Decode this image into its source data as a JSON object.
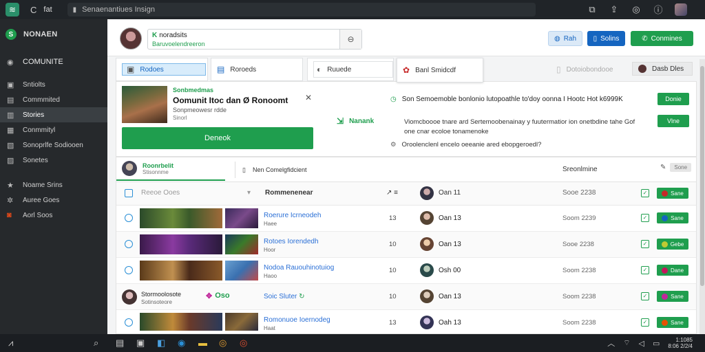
{
  "browser": {
    "back_glyph": "C",
    "tab_text": "fat",
    "address": "Senaenantiues Insign",
    "right_icons": [
      "⧉",
      "⇪",
      "◎",
      "ⓘ"
    ]
  },
  "sidebar": {
    "brand": "NONAEN",
    "section": "COMUNITE",
    "items": [
      {
        "label": "Sntiolts",
        "icon": "folder-icon"
      },
      {
        "label": "Commmited",
        "icon": "stack-icon"
      },
      {
        "label": "Stories",
        "icon": "book-icon",
        "active": true
      },
      {
        "label": "Conmmityl",
        "icon": "grid-icon"
      },
      {
        "label": "Sonoprlfe Sodiooen",
        "icon": "list-icon"
      },
      {
        "label": "Sonetes",
        "icon": "card-icon"
      }
    ],
    "items2": [
      {
        "label": "Noame Srins",
        "icon": "star-icon"
      },
      {
        "label": "Auree Goes",
        "icon": "gear-icon"
      },
      {
        "label": "Aorl Soos",
        "icon": "flag-icon"
      }
    ]
  },
  "profile": {
    "name": "noradsits",
    "subtitle": "Baruvoelendreeron",
    "buttons": {
      "b1": "Rah",
      "b2": "Solins",
      "b3": "Conmines"
    }
  },
  "tabs": {
    "t1": "Rodoes",
    "t2": "Roroeds",
    "t3": "Ruuede",
    "t4": "Banl Smidcdf",
    "t5": "Dotoiobondooe",
    "t6": "Dasb Dles"
  },
  "promo": {
    "tag": "Sonbmedmas",
    "title": "Oomunit Itoc dan Ø Ronoomt",
    "sub": "Sonpmeowesr rdde",
    "sub2": "Sinorl",
    "cta": "Deneok",
    "mid": "Nanank",
    "line1": "Son Semoemoble bonlonio lutopoathle to'doy oonna I Hootc Hot k6999K",
    "desc": "Viomcboooe tnare ard Sertemoobenainay y fuutermatior ion onetbdine tahe Gof one cnar ecoloe tonamenoke",
    "line3": "Oroolenclenl encelo oeeanie ared ebopgeroedl?",
    "btn1": "Donie",
    "btn2": "Vlne"
  },
  "table": {
    "user_name": "Roonrbelit",
    "user_sub": "Stisonnme",
    "selector": "Nen Comelgfidcient",
    "right_title": "Sreonlmine",
    "chip": "Sone",
    "cols": {
      "c1": "Reeoe Ooes",
      "c2": "Rommenenear",
      "c3": "Oan 11",
      "c4": "Sooe 2238"
    },
    "rows": [
      {
        "title": "Roerure Icrneodeh",
        "sub": "Haee",
        "num": "13",
        "name": "Oan 13",
        "date": "Soom 2239",
        "dot": "#1565c0",
        "btn": "Sane"
      },
      {
        "title": "Rotoes Iorendedh",
        "sub": "Hoor",
        "num": "10",
        "name": "Oan 13",
        "date": "Sooe 2238",
        "dot": "#7cb342",
        "btn": "Gebe"
      },
      {
        "title": "Nodoa Rauouhinotuiog",
        "sub": "Haoo",
        "num": "10",
        "name": "Osh 00",
        "date": "Soom 2238",
        "dot": "#c2185b",
        "btn": "Dane"
      },
      {
        "title": "Soic Sluter",
        "sub": "",
        "num": "10",
        "name": "Oan 13",
        "date": "Soom 2238",
        "dot": "#c0269a",
        "btn": "Sane",
        "user": true,
        "u1": "Stormoolosote",
        "u2": "Sotinsoteore",
        "logo": "Oso"
      },
      {
        "title": "Romonuoe Ioernodeg",
        "sub": "Haat",
        "num": "13",
        "name": "Oah 13",
        "date": "Soom 2238",
        "dot": "#e65100",
        "btn": "Sane"
      }
    ]
  },
  "taskbar": {
    "clock1": "1:1085",
    "clock2": "8:06 2/2/4"
  },
  "colors": {
    "accent_green": "#1f9e4e",
    "accent_blue": "#1565c0"
  }
}
